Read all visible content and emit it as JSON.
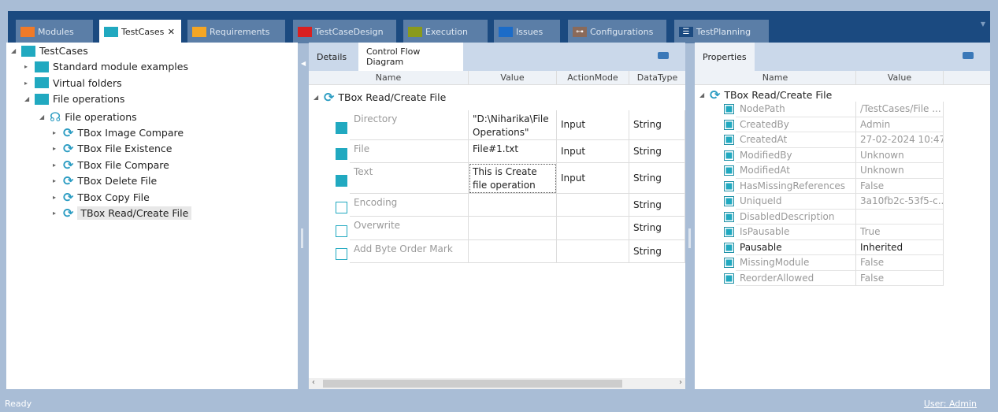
{
  "tabs": [
    {
      "label": "Modules",
      "color": "#f07a28"
    },
    {
      "label": "TestCases",
      "color": "#21a9c0",
      "active": true,
      "close": "✕"
    },
    {
      "label": "Requirements",
      "color": "#f6a623"
    },
    {
      "label": "TestCaseDesign",
      "color": "#d92020"
    },
    {
      "label": "Execution",
      "color": "#8a9a1c"
    },
    {
      "label": "Issues",
      "color": "#1c6cc8"
    },
    {
      "label": "Configurations",
      "color": "#8a6a5a",
      "icon": "⊶"
    },
    {
      "label": "TestPlanning",
      "color": "#1b4a80",
      "icon": "☰"
    }
  ],
  "tree": [
    {
      "label": "TestCases",
      "level": 0,
      "exp": "◢",
      "icon": "folder"
    },
    {
      "label": "Standard module examples",
      "level": 1,
      "exp": "▸",
      "icon": "folder"
    },
    {
      "label": "Virtual folders",
      "level": 1,
      "exp": "▸",
      "icon": "folder"
    },
    {
      "label": "File operations",
      "level": 1,
      "exp": "◢",
      "icon": "folder"
    },
    {
      "label": "File operations",
      "level": 2,
      "exp": "◢",
      "icon": "testcase"
    },
    {
      "label": "TBox Image Compare",
      "level": 3,
      "exp": "▸",
      "icon": "refresh"
    },
    {
      "label": "TBox File Existence",
      "level": 3,
      "exp": "▸",
      "icon": "refresh"
    },
    {
      "label": "TBox File Compare",
      "level": 3,
      "exp": "▸",
      "icon": "refresh"
    },
    {
      "label": "TBox Delete File",
      "level": 3,
      "exp": "▸",
      "icon": "refresh"
    },
    {
      "label": "TBox Copy File",
      "level": 3,
      "exp": "▸",
      "icon": "refresh"
    },
    {
      "label": "TBox Read/Create File",
      "level": 3,
      "exp": "▸",
      "icon": "refresh",
      "selected": true
    }
  ],
  "details": {
    "tabs": [
      "Details",
      "Control Flow Diagram"
    ],
    "columns": [
      "Name",
      "Value",
      "ActionMode",
      "DataType"
    ],
    "root": "TBox Read/Create File",
    "rows": [
      {
        "name": "Directory",
        "value": "\"D:\\Niharika\\File Operations\"",
        "mode": "Input",
        "type": "String",
        "checked": true
      },
      {
        "name": "File",
        "value": "File#1.txt",
        "mode": "Input",
        "type": "String",
        "checked": true
      },
      {
        "name": "Text",
        "value": "This is Create file operation",
        "mode": "Input",
        "type": "String",
        "checked": true
      },
      {
        "name": "Encoding",
        "value": "",
        "mode": "",
        "type": "String",
        "checked": false
      },
      {
        "name": "Overwrite",
        "value": "",
        "mode": "",
        "type": "String",
        "checked": false
      },
      {
        "name": "Add Byte Order Mark",
        "value": "",
        "mode": "",
        "type": "String",
        "checked": false
      }
    ]
  },
  "properties": {
    "tab": "Properties",
    "columns": [
      "Name",
      "Value"
    ],
    "root": "TBox Read/Create File",
    "rows": [
      {
        "name": "NodePath",
        "value": "/TestCases/File ..."
      },
      {
        "name": "CreatedBy",
        "value": "Admin"
      },
      {
        "name": "CreatedAt",
        "value": "27-02-2024 10:47..."
      },
      {
        "name": "ModifiedBy",
        "value": "Unknown"
      },
      {
        "name": "ModifiedAt",
        "value": "Unknown"
      },
      {
        "name": "HasMissingReferences",
        "value": "False"
      },
      {
        "name": "UniqueId",
        "value": "3a10fb2c-53f5-c..."
      },
      {
        "name": "DisabledDescription",
        "value": ""
      },
      {
        "name": "IsPausable",
        "value": "True"
      },
      {
        "name": "Pausable",
        "value": "Inherited",
        "editable": true
      },
      {
        "name": "MissingModule",
        "value": "False"
      },
      {
        "name": "ReorderAllowed",
        "value": "False"
      }
    ]
  },
  "status": {
    "left": "Ready",
    "user": "User: Admin"
  }
}
